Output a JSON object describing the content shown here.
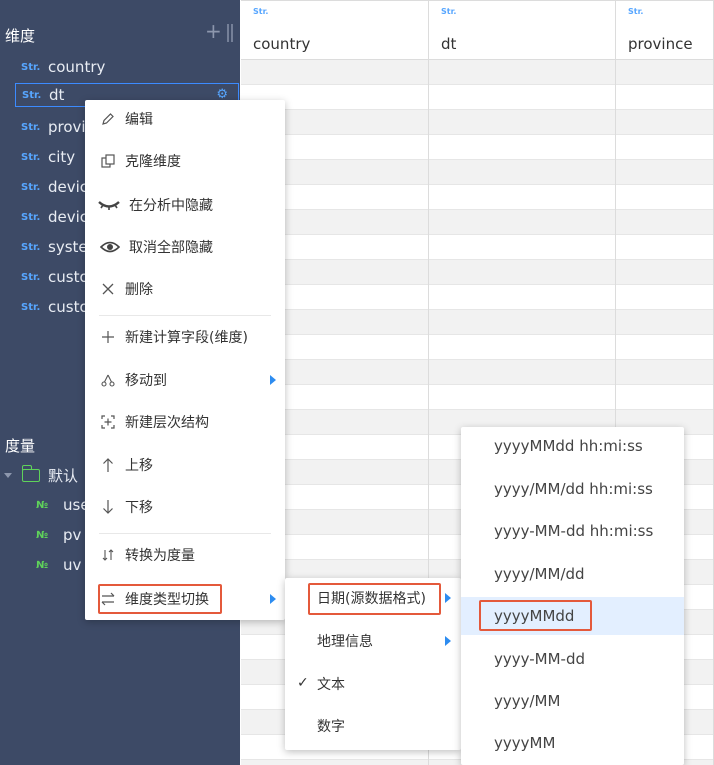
{
  "sidebar": {
    "dimension_title": "维度",
    "measure_title": "度量",
    "add_icon": "+",
    "dimensions": [
      {
        "type": "Str.",
        "name": "country"
      },
      {
        "type": "Str.",
        "name": "dt"
      },
      {
        "type": "Str.",
        "name": "province"
      },
      {
        "type": "Str.",
        "name": "city"
      },
      {
        "type": "Str.",
        "name": "device"
      },
      {
        "type": "Str.",
        "name": "device"
      },
      {
        "type": "Str.",
        "name": "system"
      },
      {
        "type": "Str.",
        "name": "custom"
      },
      {
        "type": "Str.",
        "name": "custom"
      }
    ],
    "measure_folder": "默认",
    "measures": [
      {
        "type": "№",
        "name": "user"
      },
      {
        "type": "№",
        "name": "pv"
      },
      {
        "type": "№",
        "name": "uv"
      }
    ]
  },
  "grid": {
    "columns": [
      {
        "tag": "Str.",
        "title": "country"
      },
      {
        "tag": "Str.",
        "title": "dt"
      },
      {
        "tag": "Str.",
        "title": "province"
      }
    ]
  },
  "context_menu": {
    "items": [
      {
        "icon": "pencil-icon",
        "label": "编辑"
      },
      {
        "icon": "clone-icon",
        "label": "克隆维度"
      },
      {
        "icon": "hide-icon",
        "label": "在分析中隐藏"
      },
      {
        "icon": "eye-icon",
        "label": "取消全部隐藏"
      },
      {
        "icon": "close-icon",
        "label": "删除"
      },
      {
        "icon": "plus-icon",
        "label": "新建计算字段(维度)"
      },
      {
        "icon": "move-icon",
        "label": "移动到"
      },
      {
        "icon": "hierarchy-icon",
        "label": "新建层次结构"
      },
      {
        "icon": "arrow-up-icon",
        "label": "上移"
      },
      {
        "icon": "arrow-down-icon",
        "label": "下移"
      },
      {
        "icon": "convert-icon",
        "label": "转换为度量"
      },
      {
        "icon": "switch-icon",
        "label": "维度类型切换"
      }
    ]
  },
  "type_menu": {
    "items": [
      {
        "label": "日期(源数据格式)"
      },
      {
        "label": "地理信息"
      },
      {
        "label": "文本",
        "checked": "✓"
      },
      {
        "label": "数字"
      }
    ]
  },
  "format_menu": {
    "items": [
      "yyyyMMdd hh:mi:ss",
      "yyyy/MM/dd hh:mi:ss",
      "yyyy-MM-dd hh:mi:ss",
      "yyyy/MM/dd",
      "yyyyMMdd",
      "yyyy-MM-dd",
      "yyyy/MM",
      "yyyyMM"
    ],
    "selected": "yyyyMMdd"
  },
  "colors": {
    "sidebar_bg": "#3d4a66",
    "accent": "#2d8cf0",
    "highlight_border": "#e4593b",
    "str_tag": "#57a6ff",
    "num_tag": "#5fd35a"
  }
}
